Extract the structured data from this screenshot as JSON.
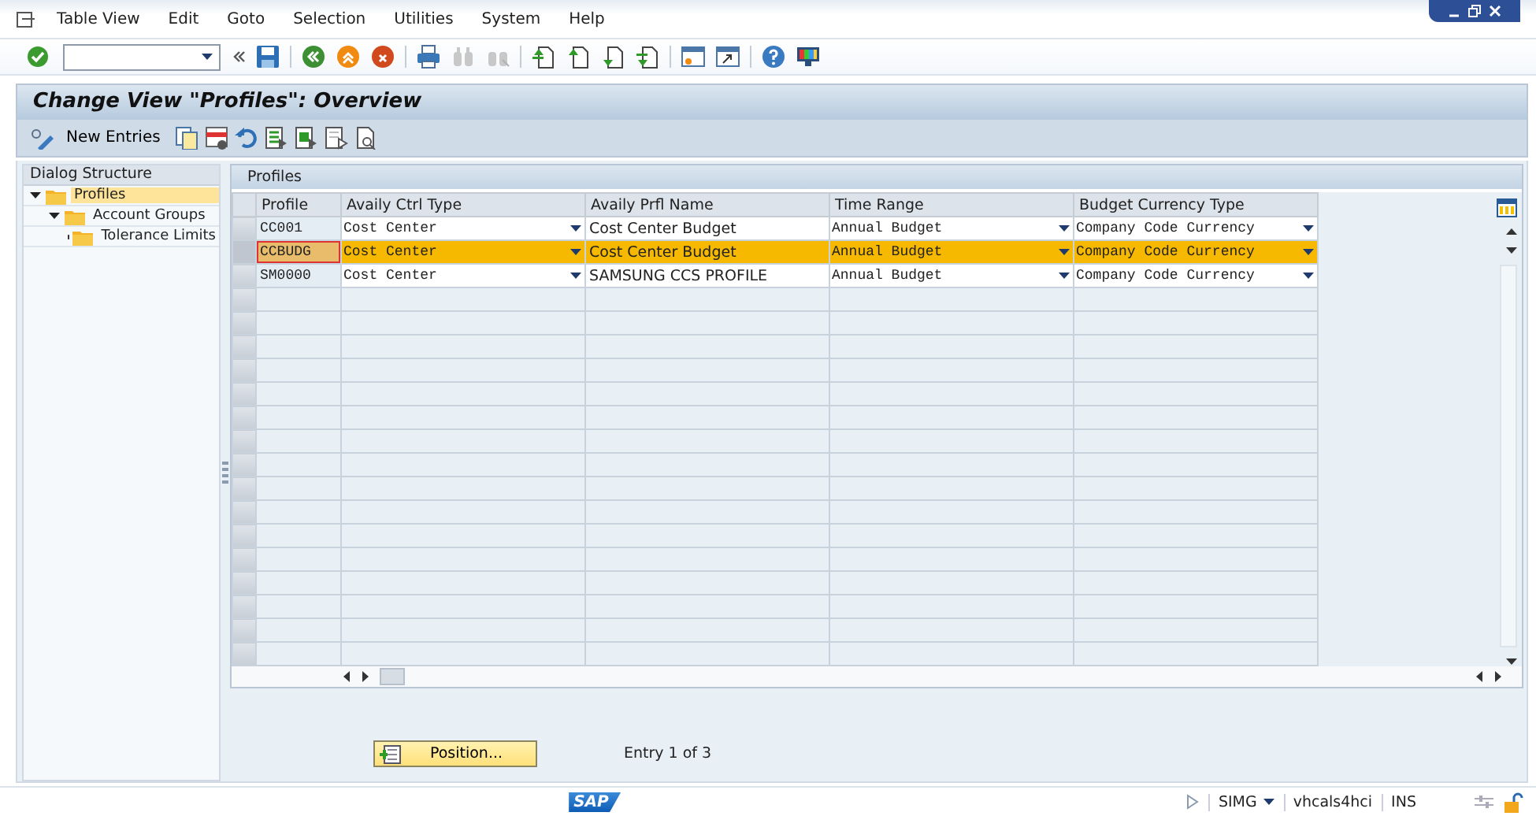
{
  "menu_bar": {
    "items": [
      "Table View",
      "Edit",
      "Goto",
      "Selection",
      "Utilities",
      "System",
      "Help"
    ]
  },
  "title": "Change View \"Profiles\": Overview",
  "app_toolbar": {
    "new_entries": "New Entries"
  },
  "dialog_structure": {
    "title": "Dialog Structure",
    "items": [
      {
        "label": "Profiles",
        "selected": true,
        "expanded": true,
        "children": [
          {
            "label": "Account Groups",
            "selected": false,
            "expanded": true,
            "children": [
              {
                "label": "Tolerance Limits",
                "selected": false
              }
            ]
          }
        ]
      }
    ]
  },
  "table": {
    "title": "Profiles",
    "columns": [
      {
        "label": "Profile",
        "kind": "text"
      },
      {
        "label": "Availy Ctrl Type",
        "kind": "dropdown"
      },
      {
        "label": "Availy Prfl Name",
        "kind": "text"
      },
      {
        "label": "Time Range",
        "kind": "dropdown"
      },
      {
        "label": "Budget Currency Type",
        "kind": "dropdown"
      }
    ],
    "rows": [
      {
        "selected": false,
        "focused": false,
        "cells": [
          "CC001",
          "Cost Center",
          "Cost Center Budget",
          "Annual Budget",
          "Company Code Currency"
        ]
      },
      {
        "selected": true,
        "focused": true,
        "cells": [
          "CCBUDG",
          "Cost Center",
          "Cost Center Budget",
          "Annual Budget",
          "Company Code Currency"
        ]
      },
      {
        "selected": false,
        "focused": false,
        "cells": [
          "SM0000",
          "Cost Center",
          "SAMSUNG CCS PROFILE",
          "Annual Budget",
          "Company Code Currency"
        ]
      }
    ]
  },
  "position_button": "Position...",
  "entry_info": "Entry 1 of 3",
  "status_bar": {
    "logo": "SAP",
    "transaction": "SIMG",
    "server": "vhcals4hci",
    "mode": "INS"
  }
}
